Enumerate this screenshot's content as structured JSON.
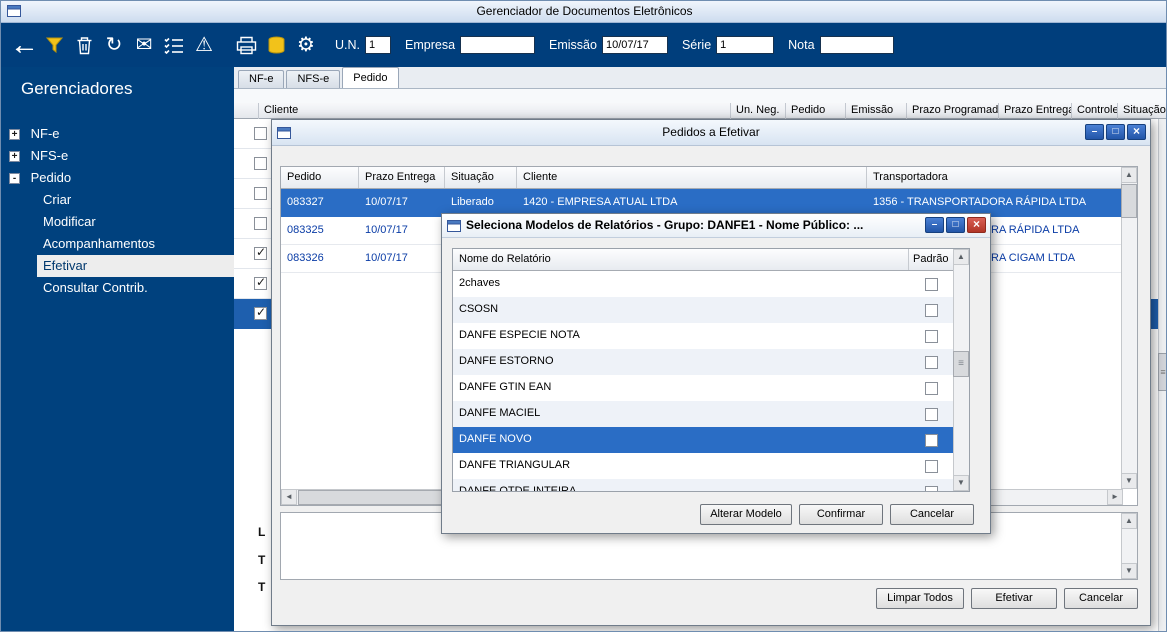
{
  "titlebar": {
    "title": "Gerenciador de Documentos Eletrônicos"
  },
  "toolbar": {
    "icons": [
      "back-icon",
      "filter-icon",
      "trash-icon",
      "refresh-icon",
      "email-icon",
      "checklist-icon",
      "warning-icon",
      "printer-icon",
      "database-icon",
      "gear-icon"
    ],
    "fields": [
      {
        "label": "U.N.",
        "value": "1"
      },
      {
        "label": "Empresa",
        "value": ""
      },
      {
        "label": "Emissão",
        "value": "10/07/17"
      },
      {
        "label": "Série",
        "value": "1"
      },
      {
        "label": "Nota",
        "value": ""
      }
    ]
  },
  "sidebar": {
    "title": "Gerenciadores",
    "items": [
      {
        "label": "NF-e",
        "glyph": "+"
      },
      {
        "label": "NFS-e",
        "glyph": "+"
      },
      {
        "label": "Pedido",
        "glyph": "-"
      },
      {
        "label": "Criar"
      },
      {
        "label": "Modificar"
      },
      {
        "label": "Acompanhamentos"
      },
      {
        "label": "Efetivar",
        "selected": true
      },
      {
        "label": "Consultar Contrib."
      }
    ]
  },
  "tabs": {
    "items": [
      "NF-e",
      "NFS-e",
      "Pedido"
    ],
    "active": "Pedido"
  },
  "main_table": {
    "columns": [
      "Cliente",
      "Un. Neg.",
      "Pedido",
      "Emissão",
      "Prazo Programado",
      "Prazo Entrega",
      "Controle",
      "Situação"
    ],
    "row_checks": [
      false,
      false,
      false,
      false,
      true,
      true,
      true
    ],
    "selected_row_index": 6,
    "fragments": [
      "L",
      "T",
      "T"
    ]
  },
  "dialog_pedidos": {
    "title": "Pedidos a Efetivar",
    "columns": [
      "Pedido",
      "Prazo Entrega",
      "Situação",
      "Cliente",
      "Transportadora"
    ],
    "rows": [
      {
        "pedido": "083327",
        "prazo": "10/07/17",
        "situacao": "Liberado",
        "cliente": "1420 - EMPRESA ATUAL LTDA",
        "transportadora": "1356 - TRANSPORTADORA RÁPIDA LTDA",
        "selected": true
      },
      {
        "pedido": "083325",
        "prazo": "10/07/17",
        "situacao": "",
        "cliente": "",
        "transportadora": "RA RÁPIDA LTDA",
        "selected": false
      },
      {
        "pedido": "083326",
        "prazo": "10/07/17",
        "situacao": "",
        "cliente": "",
        "transportadora": "RA CIGAM LTDA",
        "selected": false
      }
    ],
    "buttons": [
      "Limpar Todos",
      "Efetivar",
      "Cancelar"
    ]
  },
  "dialog_modelos": {
    "title": "Seleciona Modelos de Relatórios - Grupo: DANFE1 - Nome Público: ...",
    "columns": [
      "Nome do Relatório",
      "Padrão"
    ],
    "rows": [
      {
        "label": "2chaves",
        "checked": false
      },
      {
        "label": "CSOSN",
        "checked": false
      },
      {
        "label": "DANFE ESPECIE NOTA",
        "checked": false
      },
      {
        "label": "DANFE ESTORNO",
        "checked": false
      },
      {
        "label": "DANFE GTIN EAN",
        "checked": false
      },
      {
        "label": "DANFE MACIEL",
        "checked": false
      },
      {
        "label": "DANFE NOVO",
        "checked": false,
        "selected": true
      },
      {
        "label": "DANFE TRIANGULAR",
        "checked": false
      },
      {
        "label": "DANFE QTDE INTEIRA",
        "checked": false
      }
    ],
    "buttons": [
      "Alterar Modelo",
      "Confirmar",
      "Cancelar"
    ]
  },
  "colors": {
    "toolbar_navy": "#003e7c",
    "selection_blue": "#2a6dc5",
    "row_fragment_blue": "#1e5fae",
    "close_red": "#b13527",
    "funnel_yellow": "#f2c21a"
  }
}
